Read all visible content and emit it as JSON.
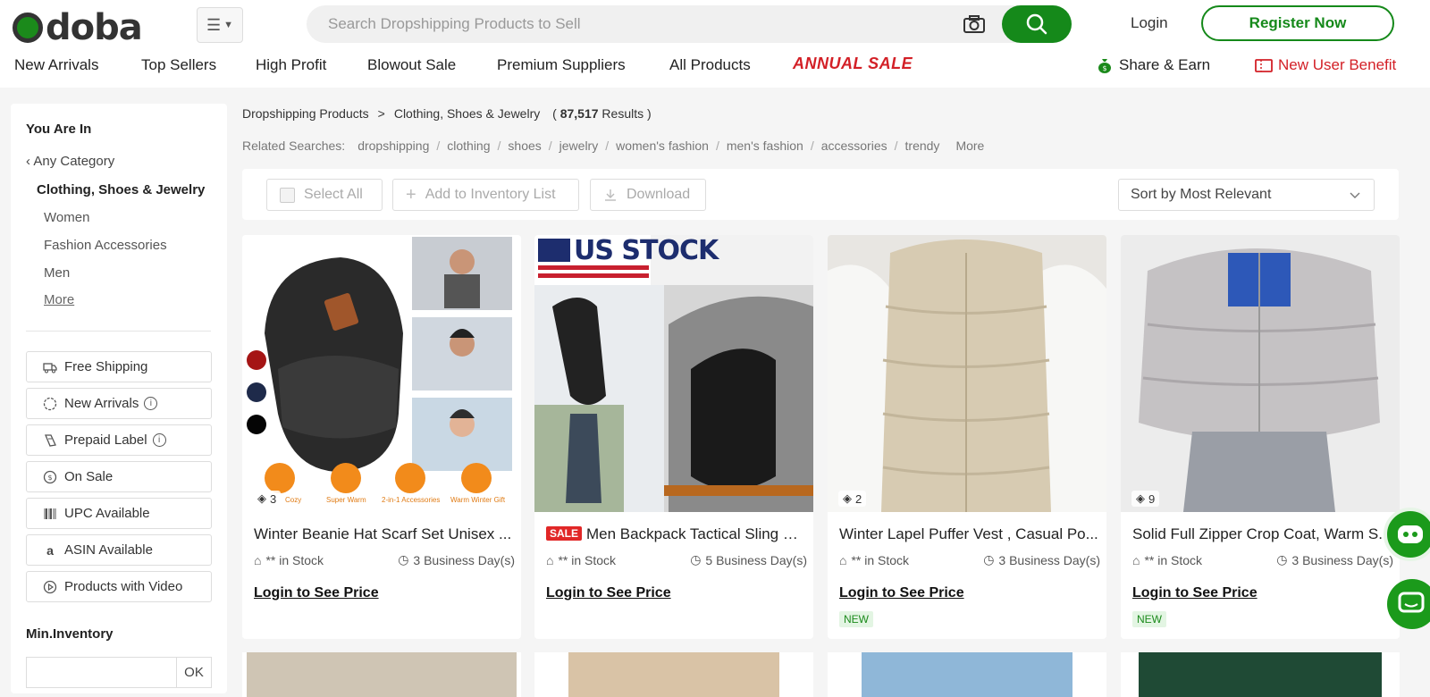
{
  "header": {
    "logo_text": "doba",
    "search_placeholder": "Search Dropshipping Products to Sell",
    "login_label": "Login",
    "register_label": "Register Now"
  },
  "nav": {
    "items": [
      "New Arrivals",
      "Top Sellers",
      "High Profit",
      "Blowout Sale",
      "Premium Suppliers",
      "All Products"
    ],
    "annual_sale": "ANNUAL SALE",
    "share_earn": "Share & Earn",
    "new_user_benefit": "New User Benefit"
  },
  "sidebar": {
    "title": "You Are In",
    "any_category": "Any Category",
    "current_category": "Clothing, Shoes & Jewelry",
    "subcategories": [
      "Women",
      "Fashion Accessories",
      "Men"
    ],
    "more_label": "More",
    "filters": [
      "Free Shipping",
      "New Arrivals",
      "Prepaid Label",
      "On Sale",
      "UPC Available",
      "ASIN Available",
      "Products with Video"
    ],
    "min_inventory_label": "Min.Inventory",
    "ok_label": "OK"
  },
  "breadcrumb": {
    "root": "Dropshipping Products",
    "separator": ">",
    "current": "Clothing, Shoes & Jewelry",
    "results_open": "(",
    "results_count": "87,517",
    "results_label": "Results )"
  },
  "related": {
    "label": "Related Searches:",
    "terms": [
      "dropshipping",
      "clothing",
      "shoes",
      "jewelry",
      "women's fashion",
      "men's fashion",
      "accessories",
      "trendy"
    ],
    "more_label": "More"
  },
  "toolbar": {
    "select_all": "Select All",
    "add_inventory": "Add to Inventory List",
    "download": "Download",
    "sort_label": "Sort by Most Relevant"
  },
  "products": [
    {
      "title": "Winter Beanie Hat Scarf Set Unisex ...",
      "stock": "** in Stock",
      "ship": "3 Business Day(s)",
      "price_label": "Login to See Price",
      "variant_count": "3",
      "sale": "",
      "new": ""
    },
    {
      "title": "Men Backpack Tactical Sling B...",
      "stock": "** in Stock",
      "ship": "5 Business Day(s)",
      "price_label": "Login to See Price",
      "variant_count": "",
      "sale": "SALE",
      "new": "",
      "us_stock": "US STOCK"
    },
    {
      "title": "Winter Lapel Puffer Vest , Casual Po...",
      "stock": "** in Stock",
      "ship": "3 Business Day(s)",
      "price_label": "Login to See Price",
      "variant_count": "2",
      "sale": "",
      "new": "NEW"
    },
    {
      "title": "Solid Full Zipper Crop Coat, Warm S...",
      "stock": "** in Stock",
      "ship": "3 Business Day(s)",
      "price_label": "Login to See Price",
      "variant_count": "9",
      "sale": "",
      "new": "NEW"
    }
  ],
  "product1_badges": [
    "Cozy",
    "Super Warm",
    "2-in-1 Accessories",
    "Warm Winter Gift"
  ],
  "colors": {
    "brand_green": "#15891a",
    "sale_red": "#d32027"
  }
}
